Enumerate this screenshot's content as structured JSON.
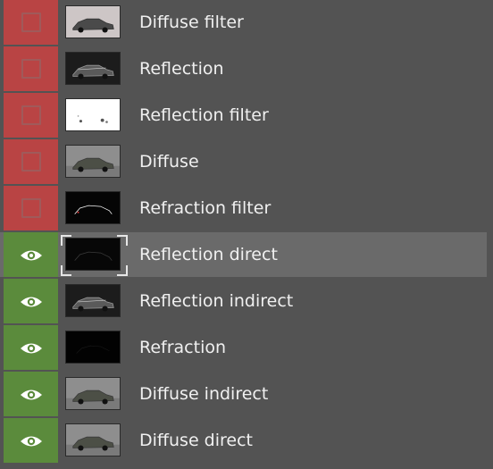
{
  "layers": [
    {
      "label": "Diffuse filter",
      "visible": false,
      "selected": false,
      "thumb": "light-bg-car"
    },
    {
      "label": "Reflection",
      "visible": false,
      "selected": false,
      "thumb": "dark-car"
    },
    {
      "label": "Reflection filter",
      "visible": false,
      "selected": false,
      "thumb": "white-sparse"
    },
    {
      "label": "Diffuse",
      "visible": false,
      "selected": false,
      "thumb": "mid-car"
    },
    {
      "label": "Refraction filter",
      "visible": false,
      "selected": false,
      "thumb": "black-red-car"
    },
    {
      "label": "Reflection direct",
      "visible": true,
      "selected": true,
      "thumb": "black-faint-car"
    },
    {
      "label": "Reflection indirect",
      "visible": true,
      "selected": false,
      "thumb": "dark-car"
    },
    {
      "label": "Refraction",
      "visible": true,
      "selected": false,
      "thumb": "black"
    },
    {
      "label": "Diffuse indirect",
      "visible": true,
      "selected": false,
      "thumb": "mid-car"
    },
    {
      "label": "Diffuse direct",
      "visible": true,
      "selected": false,
      "thumb": "mid-car"
    }
  ],
  "colors": {
    "hidden_bg": "#b94444",
    "visible_bg": "#5b8b3c",
    "row_bg": "#535353",
    "selected_bg": "#6a6a6a"
  },
  "icons": {
    "visible": "eye-icon",
    "hidden": "empty-checkbox"
  }
}
